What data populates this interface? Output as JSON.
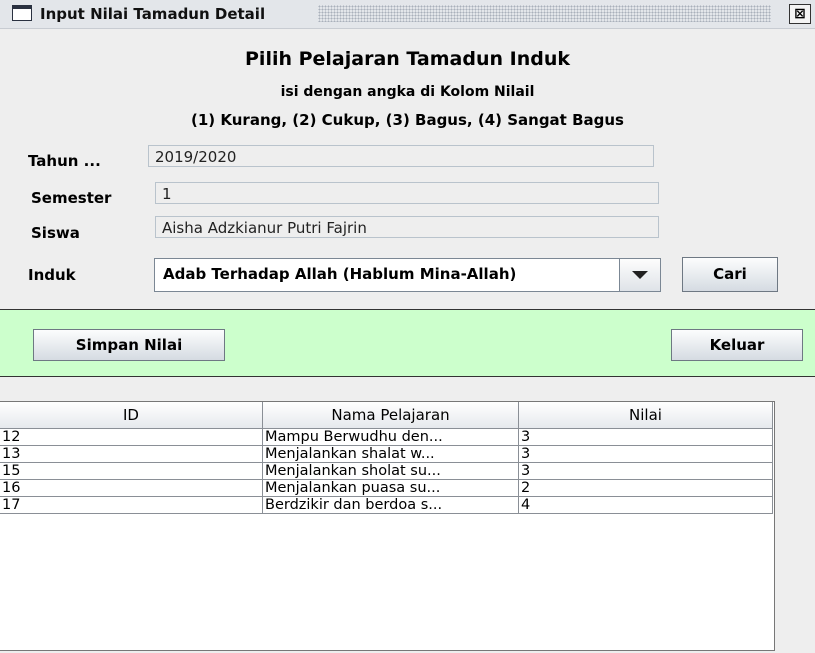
{
  "window": {
    "title": "Input Nilai Tamadun Detail",
    "close_label": "⊠"
  },
  "header": {
    "title": "Pilih Pelajaran Tamadun Induk",
    "subtitle": "isi dengan angka di Kolom Nilail",
    "scale": "(1) Kurang, (2) Cukup, (3) Bagus, (4) Sangat Bagus"
  },
  "form": {
    "tahun_label": "Tahun ...",
    "tahun_value": "2019/2020",
    "semester_label": "Semester",
    "semester_value": "1",
    "siswa_label": "Siswa",
    "siswa_value": "Aisha Adzkianur Putri Fajrin",
    "induk_label": "Induk",
    "induk_value": "Adab Terhadap Allah (Hablum Mina-Allah)",
    "cari_label": "Cari"
  },
  "actions": {
    "simpan_label": "Simpan Nilai",
    "keluar_label": "Keluar"
  },
  "table": {
    "columns": [
      "ID",
      "Nama Pelajaran",
      "Nilai"
    ],
    "rows": [
      [
        "12",
        "Mampu Berwudhu den...",
        "3"
      ],
      [
        "13",
        "Menjalankan shalat w...",
        "3"
      ],
      [
        "15",
        "Menjalankan sholat su...",
        "3"
      ],
      [
        "16",
        "Menjalankan puasa su...",
        "2"
      ],
      [
        "17",
        "Berdzikir dan berdoa s...",
        "4"
      ]
    ]
  },
  "colors": {
    "panel_green": "#ccffcc",
    "background": "#eeeeee"
  }
}
